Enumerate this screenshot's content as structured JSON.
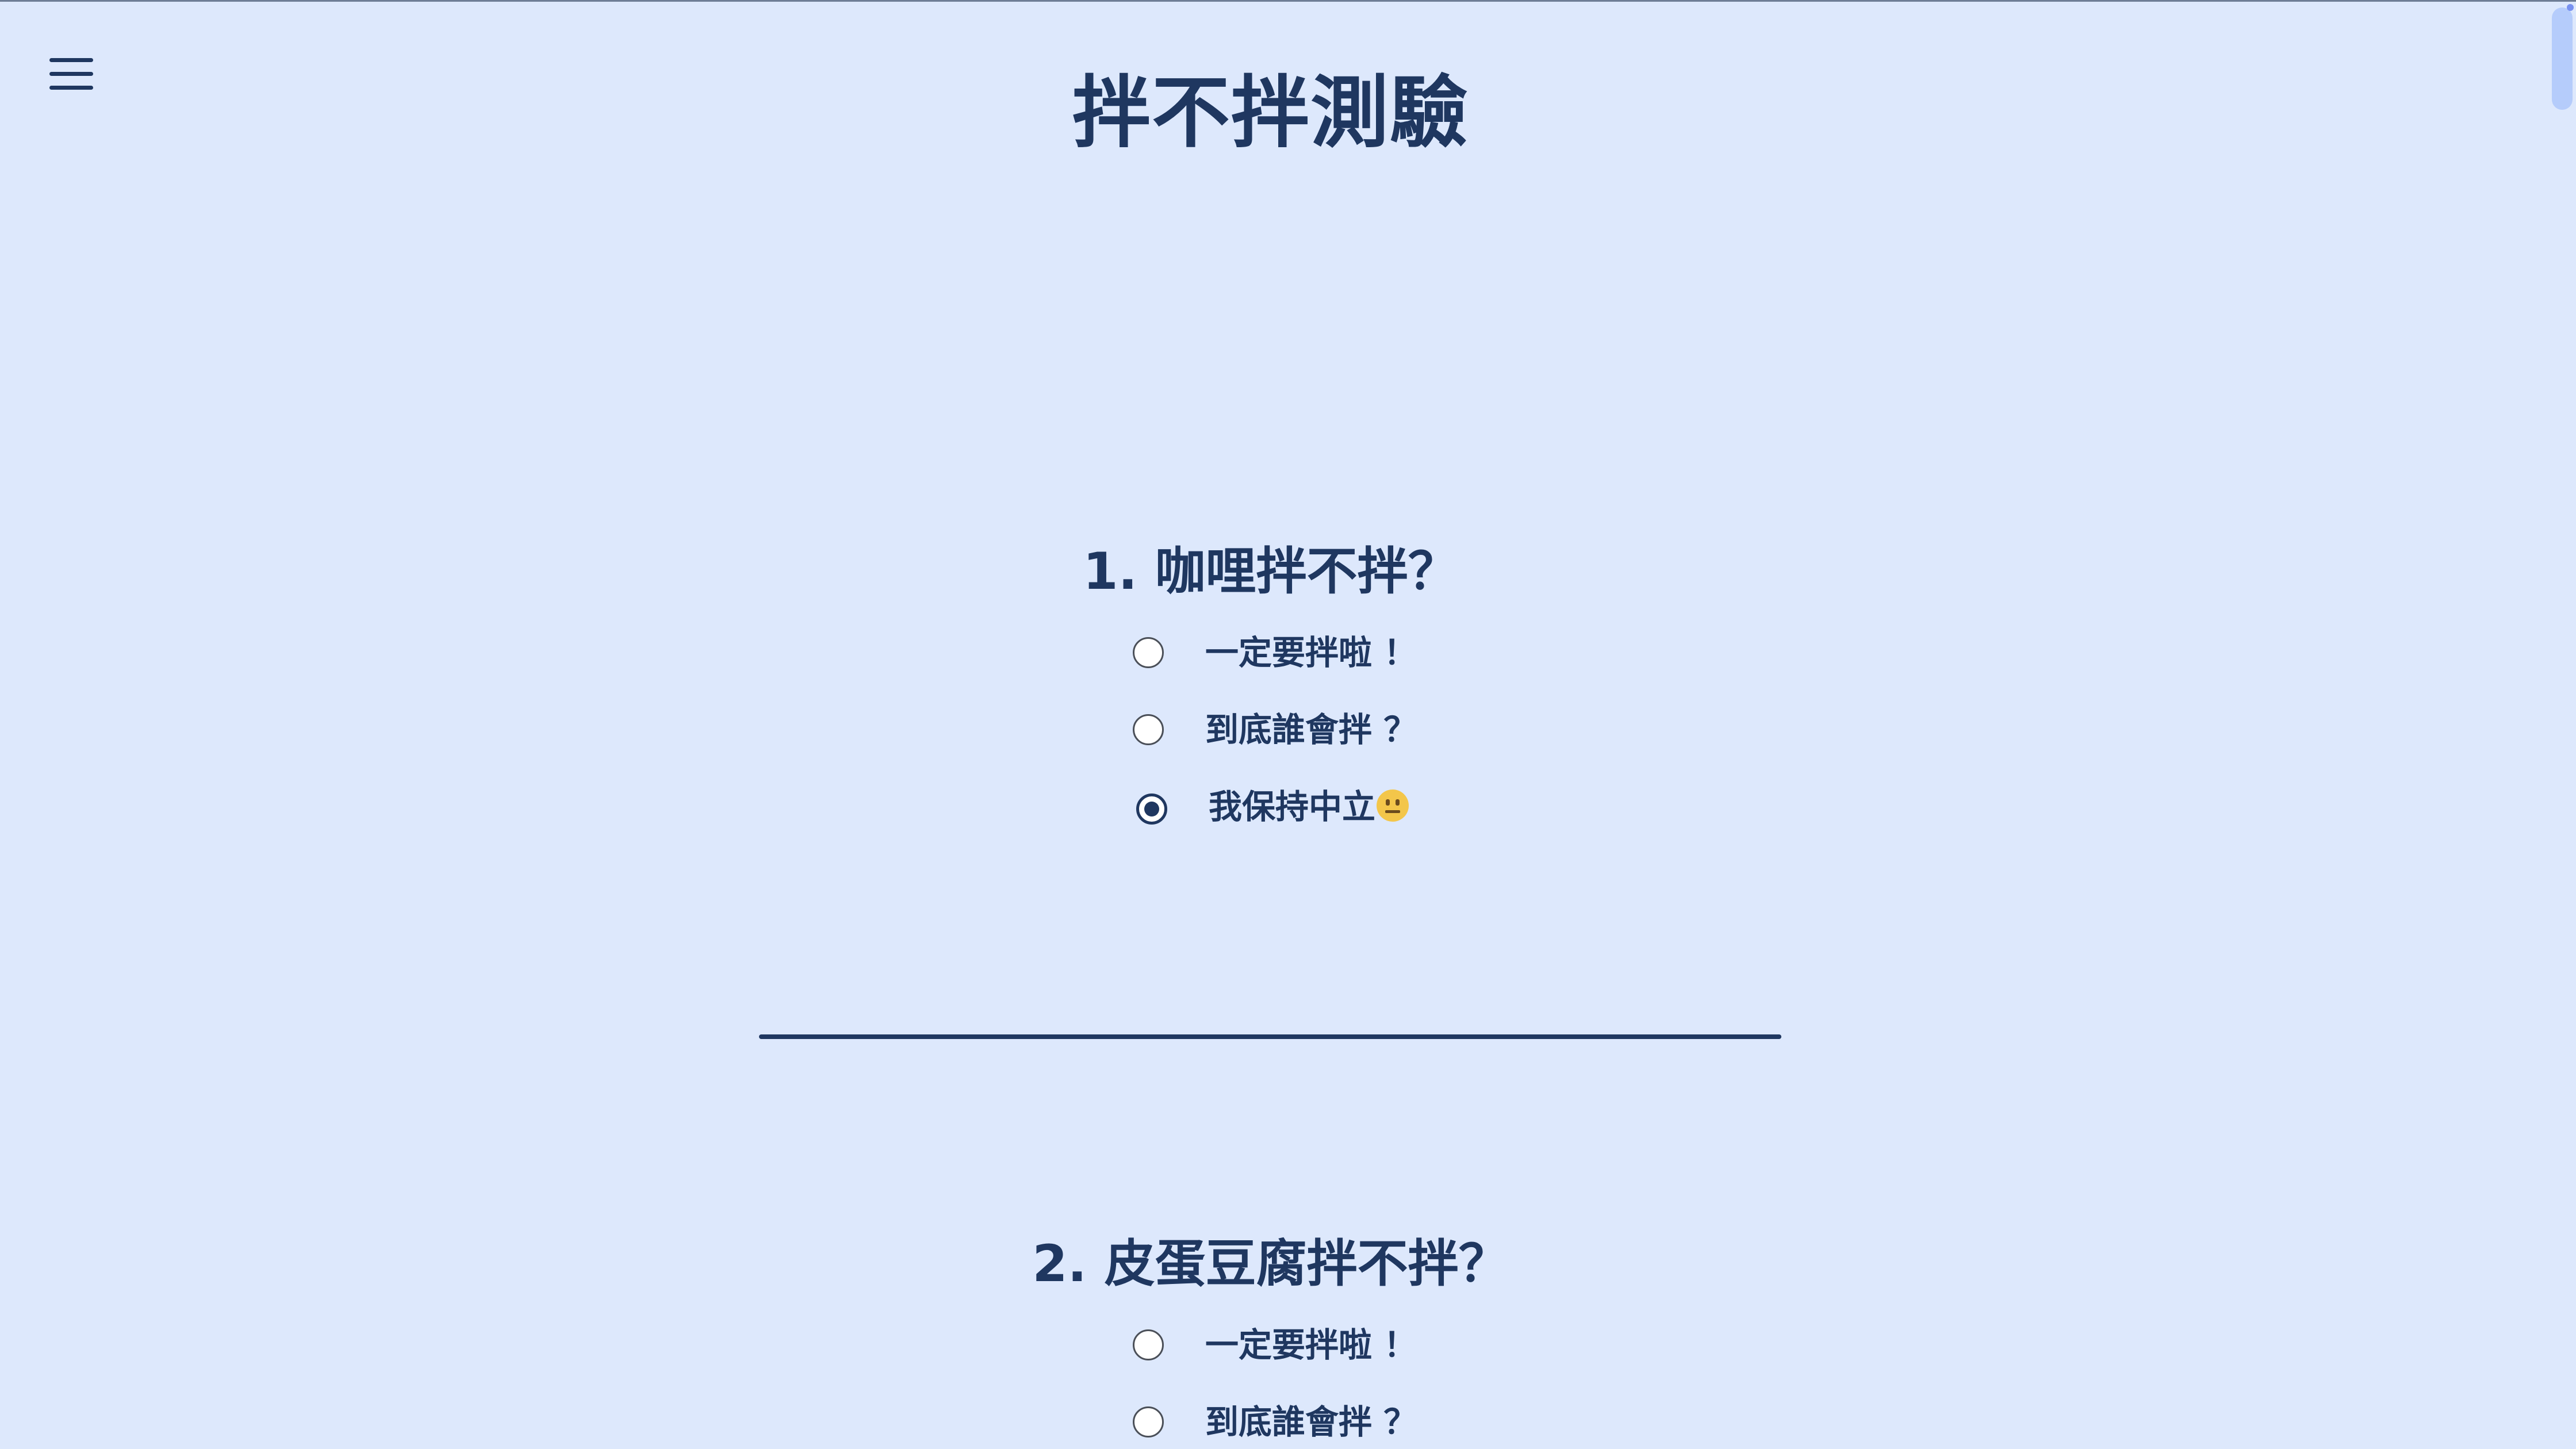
{
  "header": {
    "title": "拌不拌測驗",
    "menu_icon": "hamburger-menu-icon"
  },
  "questions": [
    {
      "title": "1. 咖哩拌不拌？",
      "options": [
        {
          "label": "一定要拌啦 ！",
          "checked": false
        },
        {
          "label": "到底誰會拌 ？",
          "checked": false
        },
        {
          "label": "我保持中立",
          "emoji": "neutral-face-emoji",
          "checked": true
        }
      ]
    },
    {
      "title": "2. 皮蛋豆腐拌不拌？",
      "options": [
        {
          "label": "一定要拌啦 ！",
          "checked": false
        },
        {
          "label": "到底誰會拌 ？",
          "checked": false
        }
      ]
    }
  ],
  "colors": {
    "background": "#dde8fc",
    "primary": "#1f3760",
    "scrollbar_thumb": "#b5ccfb"
  }
}
